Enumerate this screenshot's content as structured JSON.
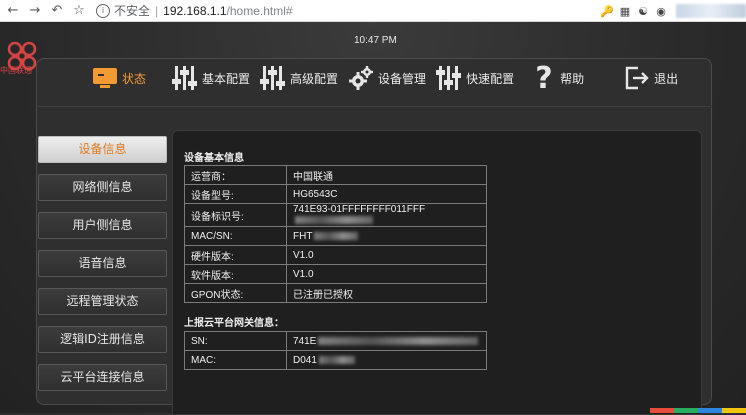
{
  "browser": {
    "insecure_label": "不安全",
    "separator": "|",
    "url_host": "192.168.1.1",
    "url_path": "/home.html#"
  },
  "header": {
    "logo_text": "中国联通",
    "time": "10:47 PM"
  },
  "tabs": [
    {
      "label": "状态",
      "icon": "monitor-icon",
      "active": true
    },
    {
      "label": "基本配置",
      "icon": "sliders-icon",
      "active": false
    },
    {
      "label": "高级配置",
      "icon": "sliders-icon",
      "active": false
    },
    {
      "label": "设备管理",
      "icon": "gear-icon",
      "active": false
    },
    {
      "label": "快速配置",
      "icon": "sliders-icon",
      "active": false
    },
    {
      "label": "帮助",
      "icon": "help-icon",
      "active": false
    },
    {
      "label": "退出",
      "icon": "exit-icon",
      "active": false
    }
  ],
  "sidebar": {
    "items": [
      {
        "label": "设备信息",
        "active": true
      },
      {
        "label": "网络侧信息"
      },
      {
        "label": "用户侧信息"
      },
      {
        "label": "语音信息"
      },
      {
        "label": "远程管理状态"
      },
      {
        "label": "逻辑ID注册信息"
      },
      {
        "label": "云平台连接信息"
      }
    ]
  },
  "basic_info": {
    "title": "设备基本信息",
    "rows": [
      {
        "key": "运营商：",
        "value": "中国联通"
      },
      {
        "key": "设备型号:",
        "value": "HG6543C"
      },
      {
        "key": "设备标识号:",
        "value": "741E93-01FFFFFFFF011FFF"
      },
      {
        "key": "MAC/SN:",
        "value": "FHT"
      },
      {
        "key": "硬件版本:",
        "value": "V1.0"
      },
      {
        "key": "软件版本:",
        "value": "V1.0"
      },
      {
        "key": "GPON状态:",
        "value": "已注册已授权"
      }
    ]
  },
  "cloud_info": {
    "title": "上报云平台网关信息：",
    "rows": [
      {
        "key": "SN:",
        "value": "741E"
      },
      {
        "key": "MAC:",
        "value": "D041"
      }
    ]
  },
  "colors": {
    "accent": "#f39a32",
    "logo_red": "#d44444",
    "background": "#2e2e2e"
  }
}
